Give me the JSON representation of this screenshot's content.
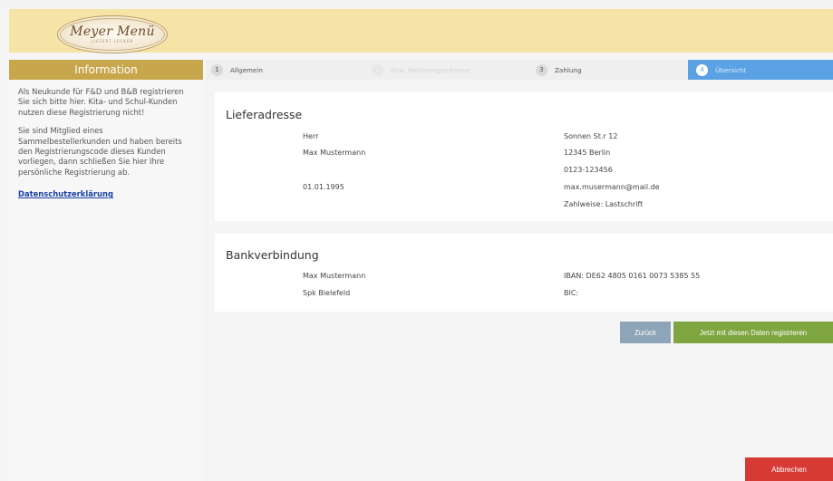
{
  "header": {
    "logo_name": "Meyer Menü",
    "logo_tagline": "LIEFERT LECKER"
  },
  "sidebar": {
    "title": "Information",
    "para1": "Als Neukunde für F&D und B&B registrieren Sie sich bitte hier. Kita- und Schul-Kunden nutzen diese Registrierung nicht!",
    "para2": "Sie sind Mitglied eines Sammelbestellerkunden und haben bereits den Registrierungscode dieses Kunden vorliegen, dann schließen Sie hier Ihre persönliche Registrierung ab.",
    "privacy_link": "Datenschutzerklärung"
  },
  "steps": [
    {
      "num": "1",
      "label": "Allgemein",
      "state": "done"
    },
    {
      "num": "2",
      "label": "Abw. Rechnungsadresse",
      "state": "disabled"
    },
    {
      "num": "3",
      "label": "Zahlung",
      "state": "done"
    },
    {
      "num": "4",
      "label": "Übersicht",
      "state": "active"
    }
  ],
  "delivery": {
    "title": "Lieferadresse",
    "salutation": "Herr",
    "name": "Max Mustermann",
    "birthdate": "01.01.1995",
    "street": "Sonnen St.r 12",
    "city": "12345 Berlin",
    "phone": "0123-123456",
    "email": "max.musermann@mail.de",
    "payment_method": "Zahlweise: Lastschrift"
  },
  "bank": {
    "title": "Bankverbindung",
    "holder": "Max Mustermann",
    "bank_name": "Spk Bielefeld",
    "iban": "IBAN: DE62 4805 0161 0073 5385 55",
    "bic": "BIC:"
  },
  "actions": {
    "back_label": "Zurück",
    "register_label": "Jetzt mit diesen Daten registrieren",
    "cancel_label": "Abbrechen"
  },
  "colors": {
    "header_bg": "#f5e4a6",
    "sidebar_title_bg": "#c8a64b",
    "active_step_bg": "#5aa2e3",
    "register_button_bg": "#7ea53f",
    "back_button_bg": "#8ea4b8",
    "cancel_button_bg": "#d63a35"
  }
}
